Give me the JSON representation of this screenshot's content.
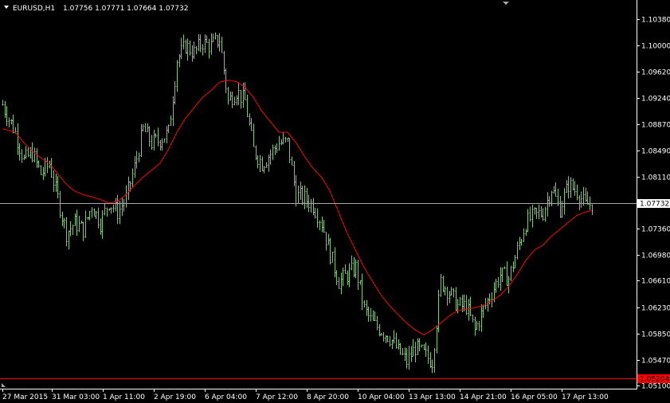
{
  "header": {
    "symbol": "EURUSD,H1",
    "ohlc": "1.07756 1.07771 1.07664 1.07732"
  },
  "colors": {
    "background": "#000000",
    "frame": "#ffffff",
    "bars": "#7cc96b",
    "moving_average": "#ff0000",
    "bid_line": "#a9a9a9",
    "level_line": "#ff0000",
    "level_badge_bg": "#ff0000",
    "level_badge_text": "#000000",
    "price_badge_bg": "#ffffff",
    "price_badge_text": "#000000",
    "axis_text": "#ffffff"
  },
  "chart_data": {
    "type": "line",
    "description_type": "ohlc-bars with moving average",
    "ylim": [
      1.051,
      1.1038
    ],
    "y_ticks": [
      "1.10380",
      "1.10000",
      "1.09620",
      "1.09240",
      "1.08870",
      "1.08490",
      "1.08110",
      "1.07360",
      "1.06980",
      "1.06610",
      "1.06230",
      "1.05850",
      "1.05470",
      "1.05100"
    ],
    "x_ticks": [
      "27 Mar 2015",
      "31 Mar 03:00",
      "1 Apr 11:00",
      "2 Apr 19:00",
      "6 Apr 04:00",
      "7 Apr 12:00",
      "8 Apr 20:00",
      "10 Apr 04:00",
      "13 Apr 13:00",
      "14 Apr 21:00",
      "16 Apr 05:00",
      "17 Apr 13:00"
    ],
    "current_price": "1.07732",
    "level_price": "1.05204",
    "price_anchors": [
      [
        0,
        1.0915
      ],
      [
        6,
        1.0875
      ],
      [
        10,
        1.0835
      ],
      [
        14,
        1.0845
      ],
      [
        18,
        1.0815
      ],
      [
        22,
        1.083
      ],
      [
        26,
        1.078
      ],
      [
        30,
        1.073
      ],
      [
        34,
        1.0745
      ],
      [
        38,
        1.0735
      ],
      [
        42,
        1.077
      ],
      [
        46,
        1.0745
      ],
      [
        50,
        1.0775
      ],
      [
        54,
        1.076
      ],
      [
        58,
        1.078
      ],
      [
        62,
        1.0825
      ],
      [
        66,
        1.088
      ],
      [
        70,
        1.086
      ],
      [
        74,
        1.0865
      ],
      [
        78,
        1.0875
      ],
      [
        82,
        1.098
      ],
      [
        86,
        1.1
      ],
      [
        90,
        1.099
      ],
      [
        94,
        1.1005
      ],
      [
        98,
        1.1
      ],
      [
        102,
        1.101
      ],
      [
        106,
        1.092
      ],
      [
        110,
        1.0935
      ],
      [
        114,
        1.092
      ],
      [
        118,
        1.085
      ],
      [
        122,
        1.083
      ],
      [
        126,
        1.0845
      ],
      [
        130,
        1.086
      ],
      [
        134,
        1.086
      ],
      [
        138,
        1.0785
      ],
      [
        142,
        1.078
      ],
      [
        146,
        1.077
      ],
      [
        150,
        1.0745
      ],
      [
        154,
        1.07
      ],
      [
        158,
        1.066
      ],
      [
        162,
        1.067
      ],
      [
        166,
        1.068
      ],
      [
        170,
        1.062
      ],
      [
        174,
        1.06
      ],
      [
        178,
        1.059
      ],
      [
        182,
        1.058
      ],
      [
        186,
        1.056
      ],
      [
        190,
        1.0545
      ],
      [
        194,
        1.0565
      ],
      [
        198,
        1.0555
      ],
      [
        202,
        1.0545
      ],
      [
        206,
        1.066
      ],
      [
        210,
        1.0645
      ],
      [
        214,
        1.0625
      ],
      [
        218,
        1.0625
      ],
      [
        222,
        1.059
      ],
      [
        226,
        1.062
      ],
      [
        230,
        1.0645
      ],
      [
        234,
        1.067
      ],
      [
        238,
        1.0665
      ],
      [
        242,
        1.0705
      ],
      [
        246,
        1.0745
      ],
      [
        250,
        1.0755
      ],
      [
        254,
        1.076
      ],
      [
        258,
        1.0795
      ],
      [
        262,
        1.0765
      ],
      [
        266,
        1.08
      ],
      [
        270,
        1.079
      ],
      [
        274,
        1.077
      ],
      [
        277,
        1.0773
      ]
    ],
    "ma_anchors": [
      [
        0,
        1.088
      ],
      [
        6,
        1.0875
      ],
      [
        10,
        1.086
      ],
      [
        14,
        1.0848
      ],
      [
        18,
        1.0838
      ],
      [
        22,
        1.083
      ],
      [
        26,
        1.0815
      ],
      [
        30,
        1.08
      ],
      [
        34,
        1.079
      ],
      [
        38,
        1.0785
      ],
      [
        42,
        1.0782
      ],
      [
        46,
        1.0778
      ],
      [
        50,
        1.0773
      ],
      [
        54,
        1.0775
      ],
      [
        58,
        1.0785
      ],
      [
        62,
        1.0798
      ],
      [
        66,
        1.081
      ],
      [
        70,
        1.082
      ],
      [
        74,
        1.083
      ],
      [
        78,
        1.085
      ],
      [
        82,
        1.0875
      ],
      [
        86,
        1.0895
      ],
      [
        90,
        1.091
      ],
      [
        94,
        1.0925
      ],
      [
        98,
        1.0935
      ],
      [
        102,
        1.0947
      ],
      [
        106,
        1.095
      ],
      [
        110,
        1.0948
      ],
      [
        114,
        1.094
      ],
      [
        118,
        1.0925
      ],
      [
        122,
        1.0905
      ],
      [
        126,
        1.089
      ],
      [
        130,
        1.0875
      ],
      [
        134,
        1.0875
      ],
      [
        138,
        1.086
      ],
      [
        142,
        1.084
      ],
      [
        146,
        1.0823
      ],
      [
        150,
        1.081
      ],
      [
        154,
        1.079
      ],
      [
        158,
        1.076
      ],
      [
        162,
        1.073
      ],
      [
        166,
        1.0705
      ],
      [
        170,
        1.068
      ],
      [
        174,
        1.066
      ],
      [
        178,
        1.064
      ],
      [
        182,
        1.0625
      ],
      [
        186,
        1.0612
      ],
      [
        190,
        1.06
      ],
      [
        194,
        1.059
      ],
      [
        198,
        1.0583
      ],
      [
        202,
        1.059
      ],
      [
        206,
        1.06
      ],
      [
        210,
        1.061
      ],
      [
        214,
        1.0618
      ],
      [
        218,
        1.062
      ],
      [
        222,
        1.0622
      ],
      [
        226,
        1.0625
      ],
      [
        230,
        1.0632
      ],
      [
        234,
        1.064
      ],
      [
        238,
        1.0653
      ],
      [
        242,
        1.067
      ],
      [
        246,
        1.069
      ],
      [
        250,
        1.0705
      ],
      [
        254,
        1.0712
      ],
      [
        258,
        1.0725
      ],
      [
        262,
        1.0735
      ],
      [
        266,
        1.0745
      ],
      [
        270,
        1.0755
      ],
      [
        274,
        1.076
      ],
      [
        277,
        1.0762
      ]
    ],
    "bar_count": 278
  }
}
